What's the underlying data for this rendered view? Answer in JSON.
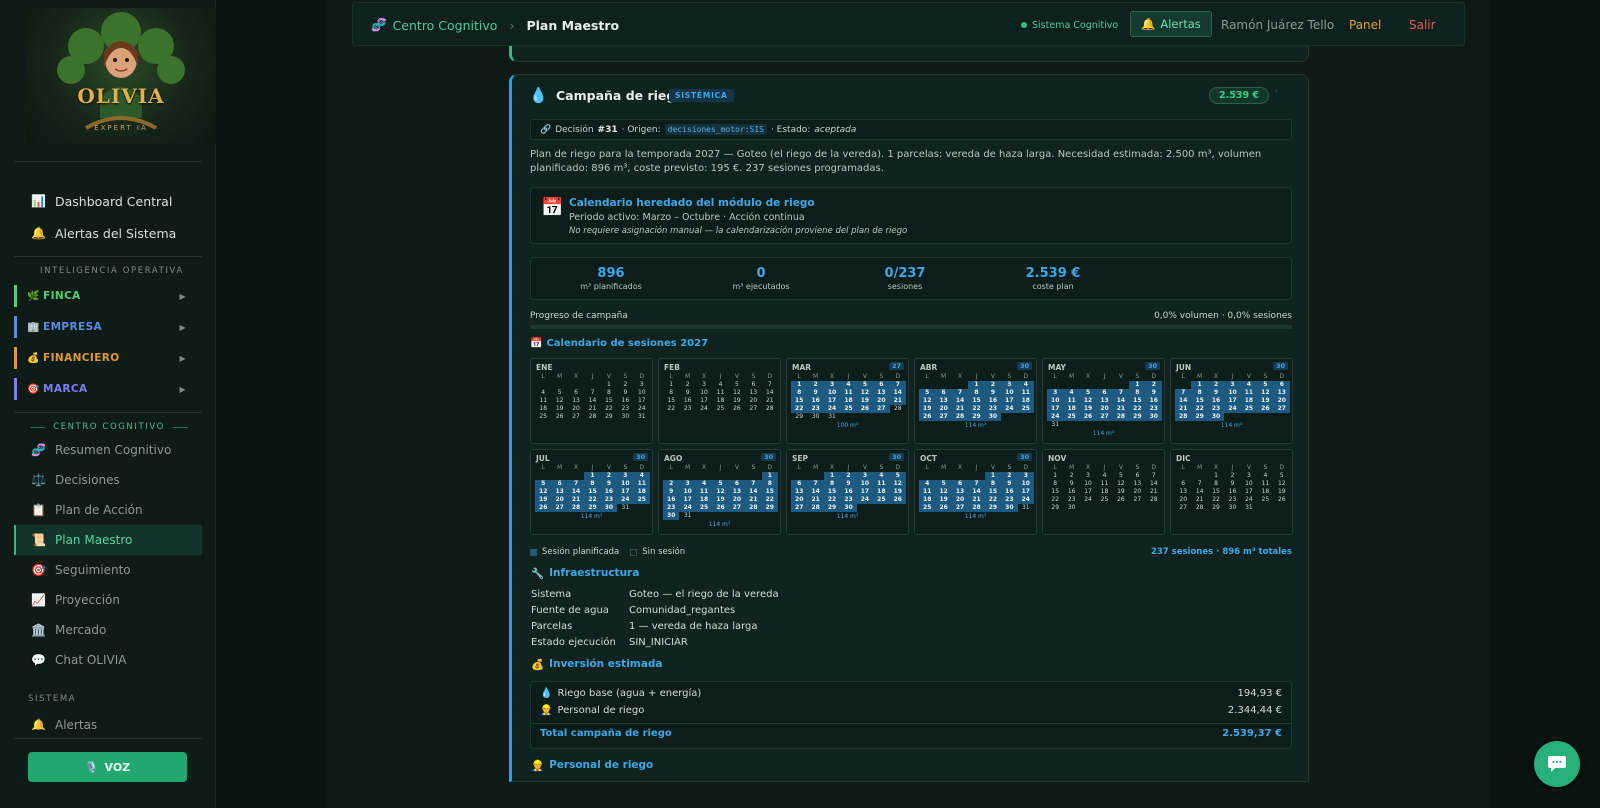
{
  "sidebar": {
    "logo_text": "OLIVIA",
    "logo_tagline": "EXPERT IA",
    "top_items": [
      {
        "icon": "📊",
        "label": "Dashboard Central"
      },
      {
        "icon": "🔔",
        "label": "Alertas del Sistema"
      }
    ],
    "section_op": "INTELIGENCIA OPERATIVA",
    "categories": [
      {
        "icon": "🌿",
        "label": "FINCA",
        "color": "#4fcf72"
      },
      {
        "icon": "🏢",
        "label": "EMPRESA",
        "color": "#5b8de0"
      },
      {
        "icon": "💰",
        "label": "FINANCIERO",
        "color": "#e09a32"
      },
      {
        "icon": "🎯",
        "label": "MARCA",
        "color": "#7e7ef0"
      }
    ],
    "section_cog": "CENTRO COGNITIVO",
    "cog_items": [
      {
        "icon": "🧬",
        "label": "Resumen Cognitivo"
      },
      {
        "icon": "⚖️",
        "label": "Decisiones"
      },
      {
        "icon": "📋",
        "label": "Plan de Acción"
      },
      {
        "icon": "📜",
        "label": "Plan Maestro"
      },
      {
        "icon": "🎯",
        "label": "Seguimiento"
      },
      {
        "icon": "📈",
        "label": "Proyección"
      },
      {
        "icon": "🏛️",
        "label": "Mercado"
      },
      {
        "icon": "💬",
        "label": "Chat OLIVIA"
      }
    ],
    "section_sys": "SISTEMA",
    "sys_items": [
      {
        "icon": "🔔",
        "label": "Alertas"
      }
    ],
    "voz_label": "VOZ",
    "voz_icon": "🎙️"
  },
  "topbar": {
    "breadcrumb_icon": "🧬",
    "breadcrumb_root": "Centro Cognitivo",
    "breadcrumb_sep": "›",
    "breadcrumb_current": "Plan Maestro",
    "status": "Sistema Cognitivo",
    "alerts_icon": "🔔",
    "alerts_label": "Alertas",
    "user": "Ramón Juárez Tello",
    "panel": "Panel",
    "logout": "Salir"
  },
  "card": {
    "icon": "💧",
    "title": "Campaña de riego",
    "badge": "SISTÉMICA",
    "amount": "2.539 €",
    "decision": {
      "prefix": "Decisión",
      "id": "#31",
      "origin_label": "· Origen:",
      "origin": "decisiones_motor:SIS",
      "state_label": "· Estado:",
      "state": "aceptada"
    },
    "description": "Plan de riego para la temporada 2027 — Goteo (el riego de la vereda). 1 parcelas: vereda de haza larga. Necesidad estimada: 2.500 m³, volumen planificado: 896 m³, coste previsto: 195 €. 237 sesiones programadas.",
    "inherited": {
      "icon": "📅",
      "title": "Calendario heredado del módulo de riego",
      "period": "Periodo activo: Marzo – Octubre · Acción continua",
      "note": "No requiere asignación manual — la calendarización proviene del plan de riego"
    },
    "stats": [
      {
        "value": "896",
        "label": "m³ planificados"
      },
      {
        "value": "0",
        "label": "m³ ejecutados"
      },
      {
        "value": "0/237",
        "label": "sesiones"
      },
      {
        "value": "2.539 €",
        "label": "coste plan"
      }
    ],
    "progress": {
      "label": "Progreso de campaña",
      "summary": "0,0% volumen · 0,0% sesiones",
      "fraction": 0
    },
    "calendar_title": "Calendario de sesiones 2027",
    "calendar_icon": "📅",
    "weekday_headers": [
      "L",
      "M",
      "X",
      "J",
      "V",
      "S",
      "D"
    ],
    "months": [
      {
        "name": "ENE",
        "offset": 4,
        "days": 31,
        "sessions": "",
        "volume": "",
        "start": 0,
        "end": 0
      },
      {
        "name": "FEB",
        "offset": 0,
        "days": 28,
        "sessions": "",
        "volume": "",
        "start": 0,
        "end": 0
      },
      {
        "name": "MAR",
        "offset": 0,
        "days": 31,
        "sessions": "27",
        "volume": "100 m³",
        "start": 1,
        "end": 27
      },
      {
        "name": "ABR",
        "offset": 3,
        "days": 30,
        "sessions": "30",
        "volume": "114 m³",
        "start": 1,
        "end": 30
      },
      {
        "name": "MAY",
        "offset": 5,
        "days": 31,
        "sessions": "30",
        "volume": "114 m³",
        "start": 1,
        "end": 30
      },
      {
        "name": "JUN",
        "offset": 1,
        "days": 30,
        "sessions": "30",
        "volume": "114 m³",
        "start": 1,
        "end": 30
      },
      {
        "name": "JUL",
        "offset": 3,
        "days": 31,
        "sessions": "30",
        "volume": "114 m³",
        "start": 1,
        "end": 30
      },
      {
        "name": "AGO",
        "offset": 6,
        "days": 31,
        "sessions": "30",
        "volume": "114 m³",
        "start": 1,
        "end": 30
      },
      {
        "name": "SEP",
        "offset": 2,
        "days": 30,
        "sessions": "30",
        "volume": "114 m³",
        "start": 1,
        "end": 30
      },
      {
        "name": "OCT",
        "offset": 4,
        "days": 31,
        "sessions": "30",
        "volume": "114 m³",
        "start": 1,
        "end": 30
      },
      {
        "name": "NOV",
        "offset": 0,
        "days": 30,
        "sessions": "",
        "volume": "",
        "start": 0,
        "end": 0
      },
      {
        "name": "DIC",
        "offset": 2,
        "days": 31,
        "sessions": "",
        "volume": "",
        "start": 0,
        "end": 0
      }
    ],
    "legend": {
      "planned": "Sesión planificada",
      "none": "Sin sesión",
      "totals": "237 sesiones · 896 m³ totales"
    },
    "infra_title": "Infraestructura",
    "infra_icon": "🔧",
    "infra": [
      {
        "label": "Sistema",
        "value": "Goteo — el riego de la vereda"
      },
      {
        "label": "Fuente de agua",
        "value": "Comunidad_regantes"
      },
      {
        "label": "Parcelas",
        "value": "1 — vereda de haza larga"
      },
      {
        "label": "Estado ejecución",
        "value": "SIN_INICIAR"
      }
    ],
    "invest_title": "Inversión estimada",
    "invest_icon": "💰",
    "invest": [
      {
        "icon": "💧",
        "label": "Riego base (agua + energía)",
        "value": "194,93 €"
      },
      {
        "icon": "👷",
        "label": "Personal de riego",
        "value": "2.344,44 €"
      }
    ],
    "invest_total": {
      "label": "Total campaña de riego",
      "value": "2.539,37 €"
    },
    "personal_title": "Personal de riego",
    "personal_icon": "👷"
  },
  "colors": {
    "accent_green": "#2fbf84",
    "accent_blue": "#3ea8e8",
    "logout": "#e05b5b",
    "panel": "#e0a040",
    "background": "#0c1512"
  }
}
